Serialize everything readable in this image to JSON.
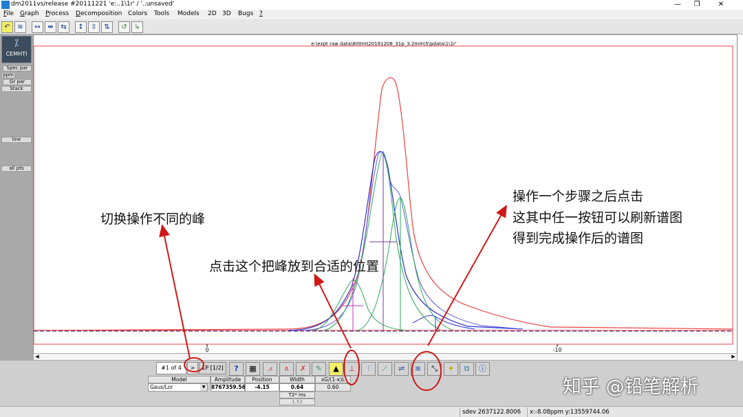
{
  "window": {
    "title": "dm2011vs/release #20111221 'e:..1\\1r' / '..unsaved'",
    "controls": [
      "—",
      "❐",
      "✕"
    ]
  },
  "menu": [
    {
      "label": "File",
      "u": "F",
      "rest": "ile"
    },
    {
      "label": "Graph",
      "u": "G",
      "rest": "raph"
    },
    {
      "label": "Process",
      "u": "P",
      "rest": "rocess"
    },
    {
      "label": "Decomposition",
      "u": "D",
      "rest": "ecomposition"
    },
    {
      "label": "Colors",
      "u": "",
      "rest": "Colors"
    },
    {
      "label": "Tools",
      "u": "",
      "rest": "Tools"
    },
    {
      "label": "Models",
      "u": "",
      "rest": "Models"
    },
    {
      "label": "2D",
      "u": "",
      "rest": "2D"
    },
    {
      "label": "3D",
      "u": "",
      "rest": "3D"
    },
    {
      "label": "Bugs",
      "u": "",
      "rest": "Bugs"
    },
    {
      "label": "?",
      "u": "?",
      "rest": ""
    }
  ],
  "toolbar_icons": [
    "undo-icon",
    "spectrum-icon",
    "expand-horizontal-icon",
    "center-horizontal-icon",
    "compress-horizontal-icon",
    "expand-vertical-icon",
    "center-vertical-icon",
    "compress-vertical-icon",
    "refresh-icon",
    "green-arrow-icon"
  ],
  "sidebar": {
    "logo_text": "CEMHTI",
    "buttons": [
      "Spec par",
      "ppm",
      "Gr par",
      "Stack",
      "line",
      "all pts"
    ]
  },
  "plot": {
    "file_path": "e:\\expt raw data\\800mt20191208_31p_3.2mm\\5\\pdata\\1\\1r'",
    "x_ticks": [
      "0",
      "-10"
    ]
  },
  "decomposition": {
    "peak_nav_label": "#1 of 4",
    "peak_nav_next": ">",
    "nmr_label": "1P [1/2]",
    "help_label": "?",
    "columns": [
      "Model",
      "Amplitude",
      "Position",
      "Width",
      "xG/(1-x)L"
    ],
    "model_value": "Gaus/Lor",
    "amplitude_value": "8767359.56",
    "position_value": "-4.15",
    "width_value": "0.64",
    "xg_value": "0.60",
    "t2_label": "T2* ms",
    "t2_value": "1.53"
  },
  "status": {
    "sdev": "sdev 2637122.8006",
    "cursor": "x:-8.08ppm y:13559744.06"
  },
  "annotations": {
    "switch_peak": "切换操作不同的峰",
    "place_peak": "点击这个把峰放到合适的位置",
    "refresh_line1": "操作一个步骤之后点击",
    "refresh_line2": "这其中任一按钮可以刷新谱图",
    "refresh_line3": "得到完成操作后的谱图"
  },
  "watermark": "知乎 @铅笔解析",
  "colors": {
    "sum_curve": "#e84040",
    "components": "#2a2ad0",
    "green_components": "#2aa85a",
    "magenta": "#c030c0",
    "annotation_red": "#d01818"
  }
}
